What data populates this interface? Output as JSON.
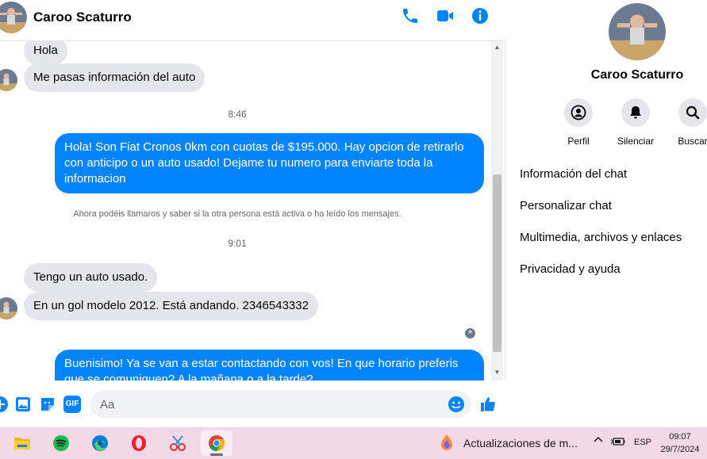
{
  "chat": {
    "contact_name": "Caroo Scaturro",
    "header_icons": [
      "phone-icon",
      "video-call-icon",
      "info-icon"
    ],
    "messages": [
      {
        "from": "contact",
        "text": "Hola"
      },
      {
        "from": "contact",
        "text": "Me pasas información del auto"
      },
      {
        "type": "time",
        "text": "8:46"
      },
      {
        "from": "me",
        "text": "Hola! Son Fiat Cronos 0km con cuotas de $195.000. Hay opcion de retirarlo con anticipo o un auto usado! Dejame tu numero para enviarte toda la informacion"
      },
      {
        "type": "notice",
        "text": "Ahora podéis llamaros y saber si la otra persona está activa o ha leído los mensajes."
      },
      {
        "type": "time",
        "text": "9:01"
      },
      {
        "from": "contact",
        "text": "Tengo un auto usado."
      },
      {
        "from": "contact",
        "text": "En un gol modelo 2012. Está andando. 2346543332"
      },
      {
        "from": "me",
        "text": "Buenisimo! Ya se van a estar contactando con vos! En que horario preferis que se comuniquen? A la mañana o a la tarde?"
      }
    ],
    "composer": {
      "placeholder": "Aa",
      "icons": [
        "plus-icon",
        "image-icon",
        "sticker-icon",
        "gif-icon",
        "emoji-icon",
        "thumbs-up-icon"
      ],
      "gif_label": "GIF"
    }
  },
  "info_panel": {
    "name": "Caroo Scaturro",
    "actions": [
      {
        "label": "Perfil",
        "icon": "profile-icon"
      },
      {
        "label": "Silenciar",
        "icon": "bell-icon"
      },
      {
        "label": "Buscar",
        "icon": "search-icon"
      }
    ],
    "menu": [
      "Información del chat",
      "Personalizar chat",
      "Multimedia, archivos y enlaces",
      "Privacidad y ayuda"
    ]
  },
  "taskbar": {
    "apps": [
      "file-explorer-icon",
      "spotify-icon",
      "edge-icon",
      "opera-icon",
      "snipping-tool-icon",
      "chrome-icon"
    ],
    "news_text": "Actualizaciones de m...",
    "tray": {
      "language": "ESP"
    },
    "clock": {
      "time": "09:07",
      "date": "29/7/2024"
    }
  },
  "colors": {
    "accent": "#0084ff",
    "incoming_bubble": "#e4e6eb",
    "taskbar": "#f2d7e5"
  }
}
